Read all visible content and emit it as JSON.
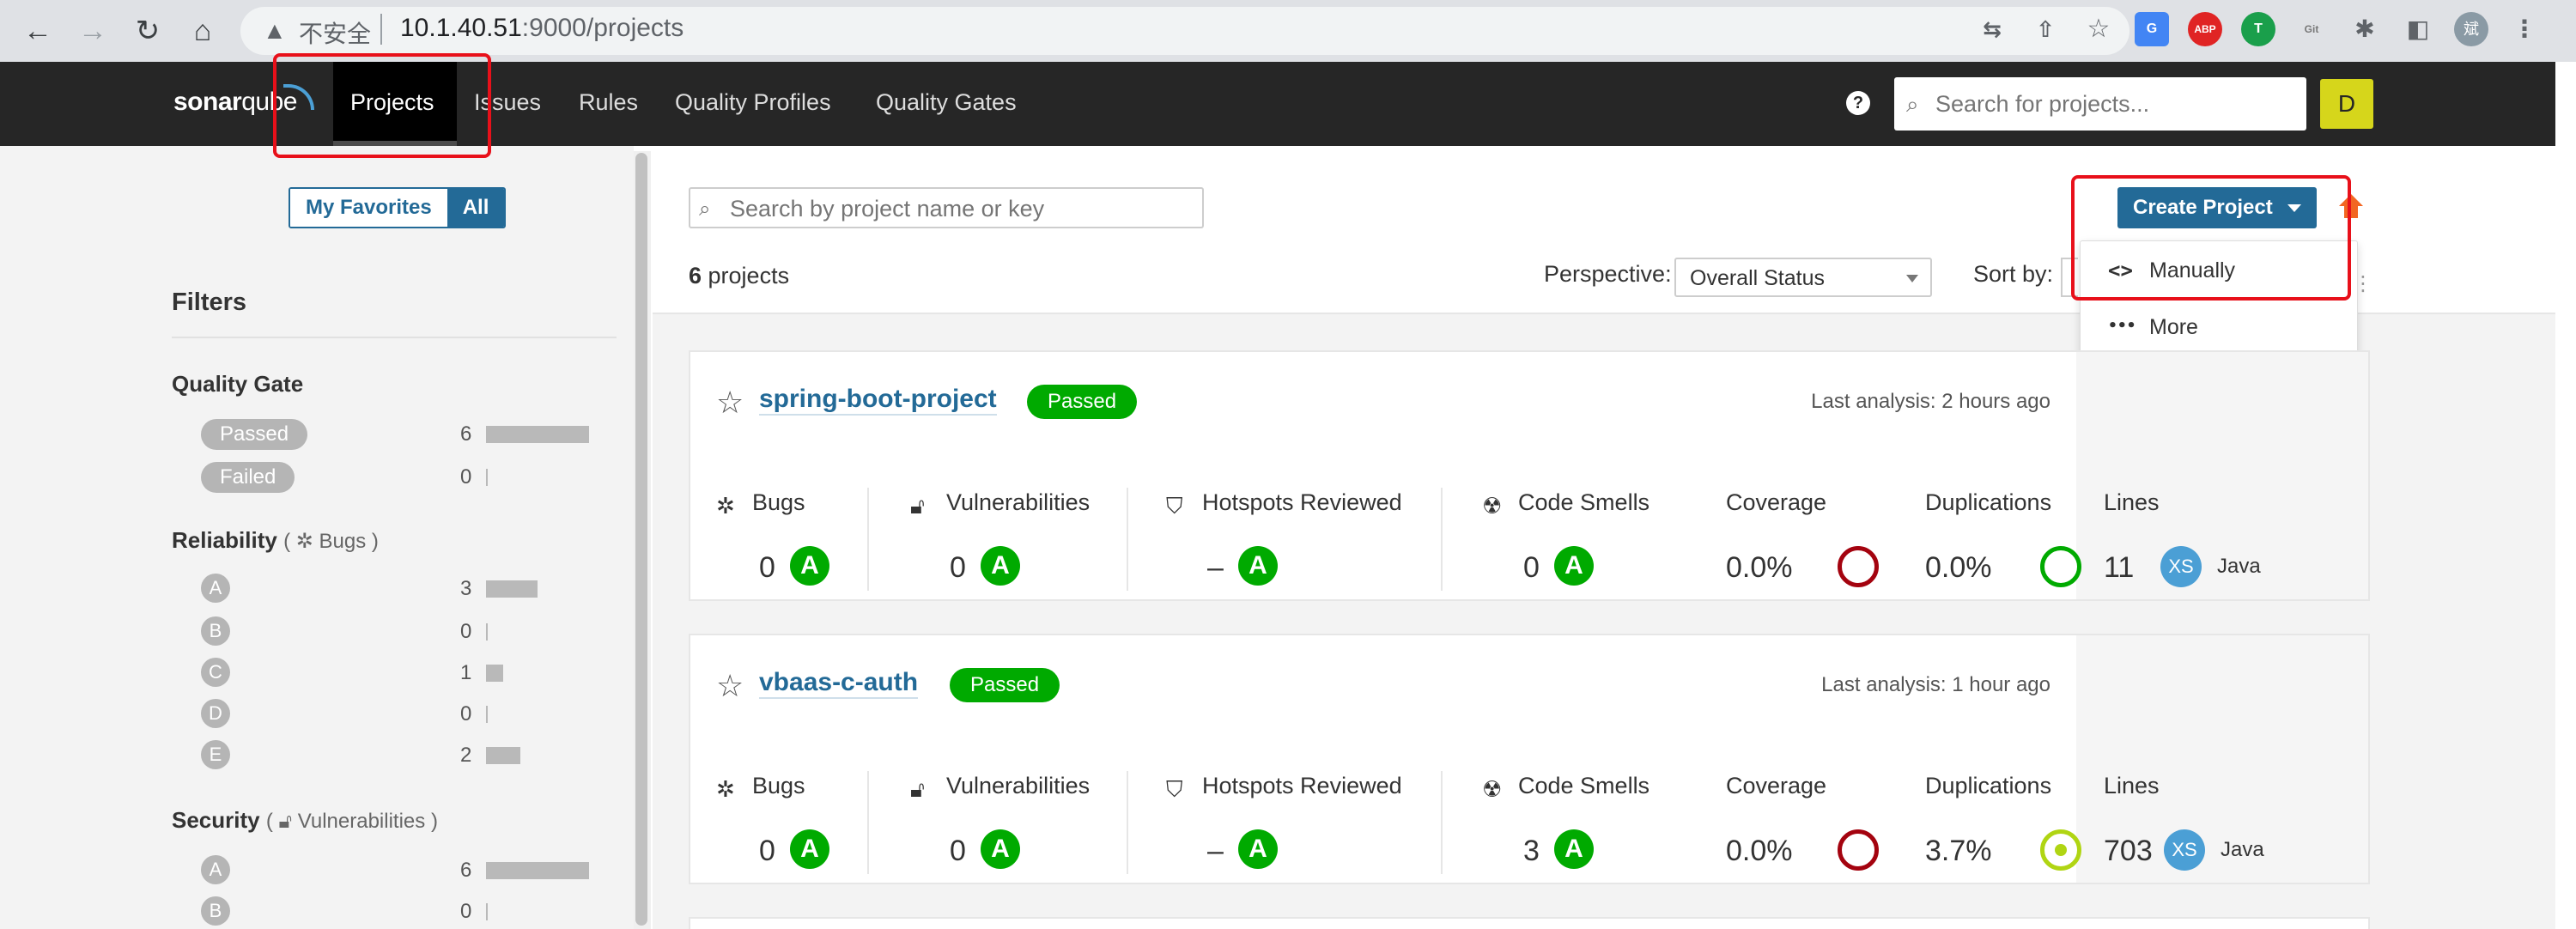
{
  "browser": {
    "back": "←",
    "forward": "→",
    "reload": "↻",
    "home": "⌂",
    "insecure_label": "不安全",
    "url_host": "10.1.40.51",
    "url_rest": ":9000/projects",
    "profile_initial": "斌"
  },
  "topnav": {
    "logo_bold": "sonar",
    "logo_light": "qube",
    "items": [
      "Projects",
      "Issues",
      "Rules",
      "Quality Profiles",
      "Quality Gates"
    ],
    "help": "?",
    "search_placeholder": "Search for projects...",
    "user_initial": "D"
  },
  "sidebar": {
    "favorites_label": "My Favorites",
    "all_label": "All",
    "filters_title": "Filters",
    "quality_gate": {
      "title": "Quality Gate",
      "options": [
        {
          "label": "Passed",
          "count": "6",
          "fraction": 1.0
        },
        {
          "label": "Failed",
          "count": "0",
          "fraction": 0
        }
      ]
    },
    "reliability": {
      "title": "Reliability",
      "sub": "Bugs",
      "ratings": [
        {
          "label": "A",
          "count": "3",
          "fraction": 0.5
        },
        {
          "label": "B",
          "count": "0",
          "fraction": 0
        },
        {
          "label": "C",
          "count": "1",
          "fraction": 0.17
        },
        {
          "label": "D",
          "count": "0",
          "fraction": 0
        },
        {
          "label": "E",
          "count": "2",
          "fraction": 0.33
        }
      ]
    },
    "security": {
      "title": "Security",
      "sub": "Vulnerabilities",
      "ratings": [
        {
          "label": "A",
          "count": "6",
          "fraction": 1.0
        },
        {
          "label": "B",
          "count": "0",
          "fraction": 0
        }
      ]
    }
  },
  "main": {
    "search_placeholder": "Search by project name or key",
    "project_count": "6",
    "project_count_suffix": " projects",
    "perspective_label": "Perspective:",
    "perspective_value": "Overall Status",
    "sort_label": "Sort by:",
    "create_button": "Create Project",
    "dropdown": {
      "manually_icon": "<>",
      "manually": "Manually",
      "more_icon": "•••",
      "more": "More"
    }
  },
  "metric_labels": {
    "bugs": "Bugs",
    "vulnerabilities": "Vulnerabilities",
    "hotspots": "Hotspots Reviewed",
    "code_smells": "Code Smells",
    "coverage": "Coverage",
    "duplications": "Duplications",
    "lines": "Lines"
  },
  "projects": [
    {
      "name": "spring-boot-project",
      "status": "Passed",
      "last_analysis": "Last analysis: 2 hours ago",
      "bugs": "0",
      "bugs_rating": "A",
      "vulnerabilities": "0",
      "vulnerabilities_rating": "A",
      "hotspots": "–",
      "hotspots_rating": "A",
      "code_smells": "0",
      "code_smells_rating": "A",
      "coverage": "0.0%",
      "duplications": "0.0%",
      "lines": "11",
      "size": "XS",
      "language": "Java"
    },
    {
      "name": "vbaas-c-auth",
      "status": "Passed",
      "last_analysis": "Last analysis: 1 hour ago",
      "bugs": "0",
      "bugs_rating": "A",
      "vulnerabilities": "0",
      "vulnerabilities_rating": "A",
      "hotspots": "–",
      "hotspots_rating": "A",
      "code_smells": "3",
      "code_smells_rating": "A",
      "coverage": "0.0%",
      "duplications": "3.7%",
      "lines": "703",
      "size": "XS",
      "language": "Java"
    }
  ],
  "colors": {
    "accent": "#236a97",
    "passed": "#00aa00",
    "coverage_ring": "#a4030f",
    "highlight": "#e8101a"
  }
}
